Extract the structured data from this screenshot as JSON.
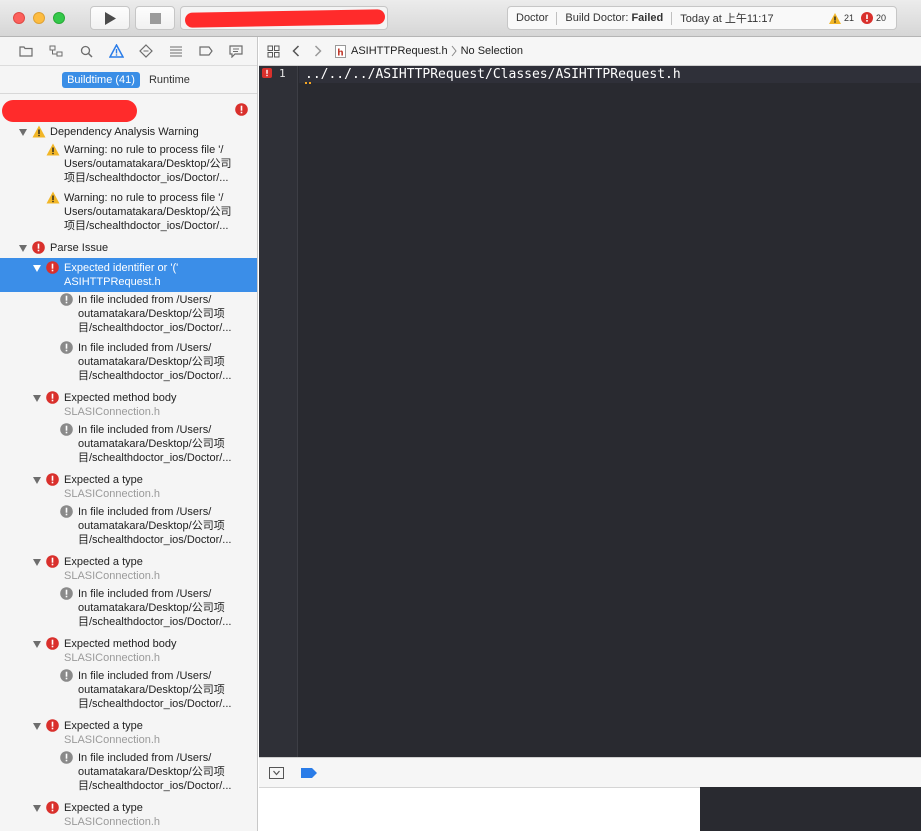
{
  "toolbar": {
    "scheme_target": "Doctor",
    "activity": {
      "target": "Doctor",
      "status_prefix": "Build Doctor: ",
      "status_value": "Failed",
      "time": "Today at 上午11:17",
      "warning_count": "21",
      "error_count": "20"
    }
  },
  "navigator": {
    "filter": {
      "buildtime": "Buildtime (41)",
      "runtime": "Runtime"
    },
    "groups": [
      {
        "title": "Dependency Analysis Warning",
        "kind": "warning",
        "items": [
          {
            "lines": [
              "Warning: no rule to process file '/",
              "Users/outamatakara/Desktop/公司",
              "项目/schealthdoctor_ios/Doctor/..."
            ]
          },
          {
            "lines": [
              "Warning: no rule to process file '/",
              "Users/outamatakara/Desktop/公司",
              "项目/schealthdoctor_ios/Doctor/..."
            ]
          }
        ]
      },
      {
        "title": "Parse Issue",
        "kind": "error",
        "issues": [
          {
            "title": "Expected identifier or '('",
            "file": "ASIHTTPRequest.h",
            "selected": true,
            "notes": [
              [
                "In file included from /Users/",
                "outamatakara/Desktop/公司项",
                "目/schealthdoctor_ios/Doctor/..."
              ],
              [
                "In file included from /Users/",
                "outamatakara/Desktop/公司项",
                "目/schealthdoctor_ios/Doctor/..."
              ]
            ]
          },
          {
            "title": "Expected method body",
            "file": "SLASIConnection.h",
            "notes": [
              [
                "In file included from /Users/",
                "outamatakara/Desktop/公司项",
                "目/schealthdoctor_ios/Doctor/..."
              ]
            ]
          },
          {
            "title": "Expected a type",
            "file": "SLASIConnection.h",
            "notes": [
              [
                "In file included from /Users/",
                "outamatakara/Desktop/公司项",
                "目/schealthdoctor_ios/Doctor/..."
              ]
            ]
          },
          {
            "title": "Expected a type",
            "file": "SLASIConnection.h",
            "notes": [
              [
                "In file included from /Users/",
                "outamatakara/Desktop/公司项",
                "目/schealthdoctor_ios/Doctor/..."
              ]
            ]
          },
          {
            "title": "Expected method body",
            "file": "SLASIConnection.h",
            "notes": [
              [
                "In file included from /Users/",
                "outamatakara/Desktop/公司项",
                "目/schealthdoctor_ios/Doctor/..."
              ]
            ]
          },
          {
            "title": "Expected a type",
            "file": "SLASIConnection.h",
            "notes": [
              [
                "In file included from /Users/",
                "outamatakara/Desktop/公司项",
                "目/schealthdoctor_ios/Doctor/..."
              ]
            ]
          },
          {
            "title": "Expected a type",
            "file": "SLASIConnection.h",
            "notes": []
          }
        ]
      }
    ]
  },
  "editor": {
    "jumpbar": {
      "file": "ASIHTTPRequest.h",
      "selection": "No Selection"
    },
    "lines": [
      {
        "number": "1",
        "text": "../../../ASIHTTPRequest/Classes/ASIHTTPRequest.h"
      }
    ]
  },
  "colors": {
    "accent": "#3b8ee8",
    "error": "#d9302c",
    "warning": "#f2b626",
    "editor_bg": "#292a30"
  }
}
